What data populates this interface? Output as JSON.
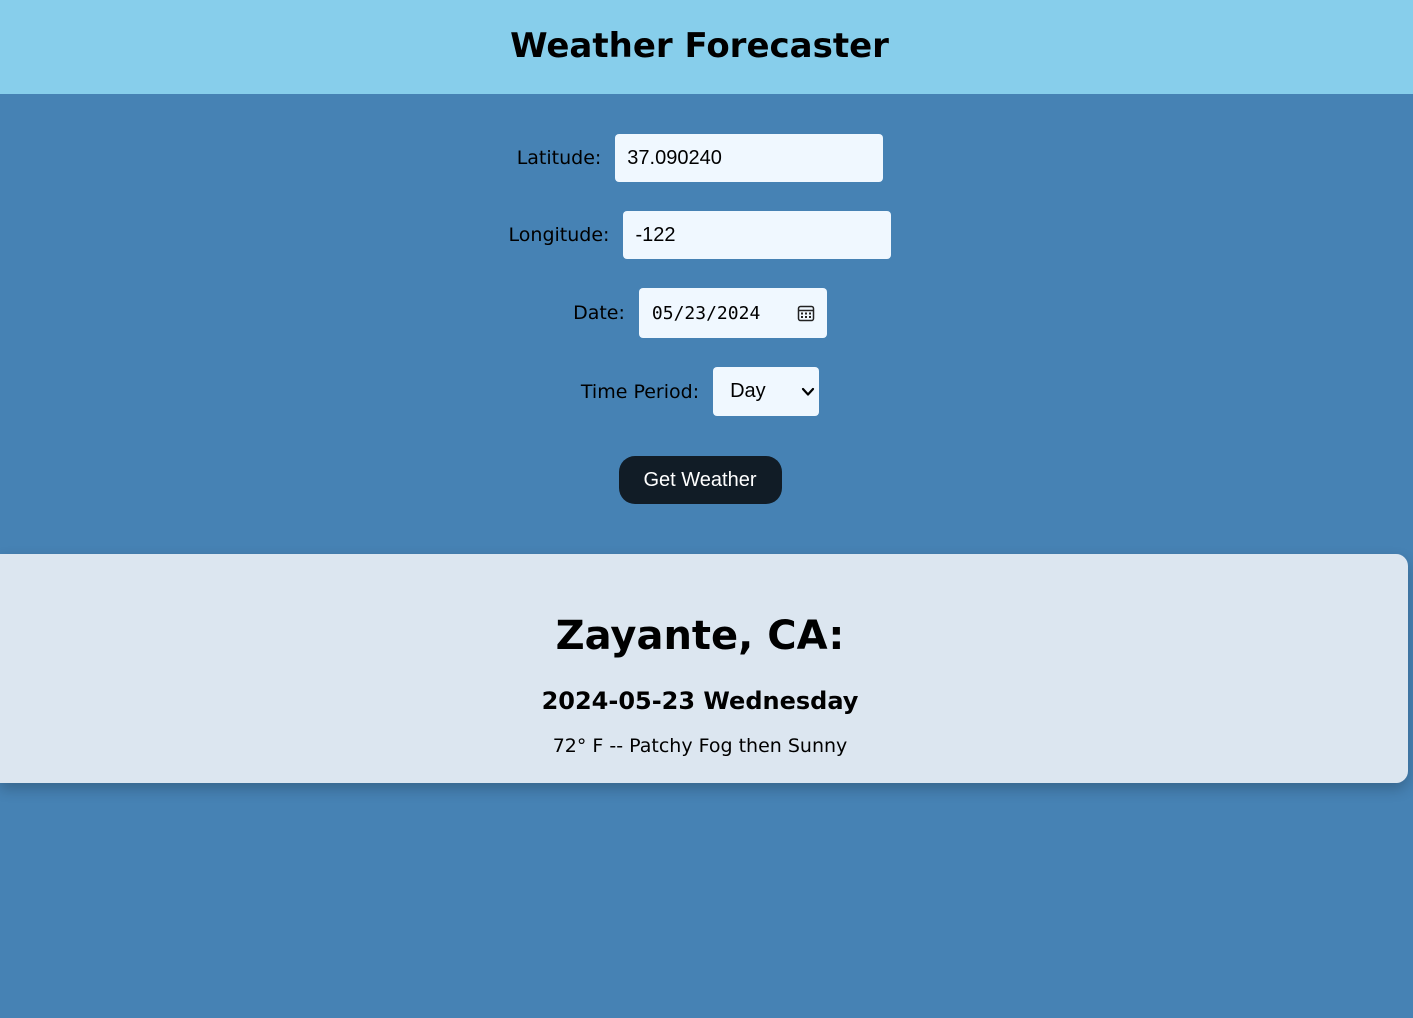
{
  "header": {
    "title": "Weather Forecaster"
  },
  "form": {
    "latitude_label": "Latitude:",
    "latitude_value": "37.090240",
    "longitude_label": "Longitude:",
    "longitude_value": "-122",
    "date_label": "Date:",
    "date_value": "05/23/2024",
    "period_label": "Time Period:",
    "period_selected": "Day",
    "submit_label": "Get Weather"
  },
  "result": {
    "location": "Zayante, CA:",
    "date_heading": "2024-05-23 Wednesday",
    "forecast": "72° F -- Patchy Fog then Sunny"
  },
  "colors": {
    "page_bg": "#4682b4",
    "header_bg": "#87ceeb",
    "input_bg": "#f0f8ff",
    "button_bg": "#111c26",
    "card_bg": "#dce6f0"
  },
  "icons": {
    "date_picker": "calendar-icon",
    "select_arrow": "chevron-down-icon"
  }
}
